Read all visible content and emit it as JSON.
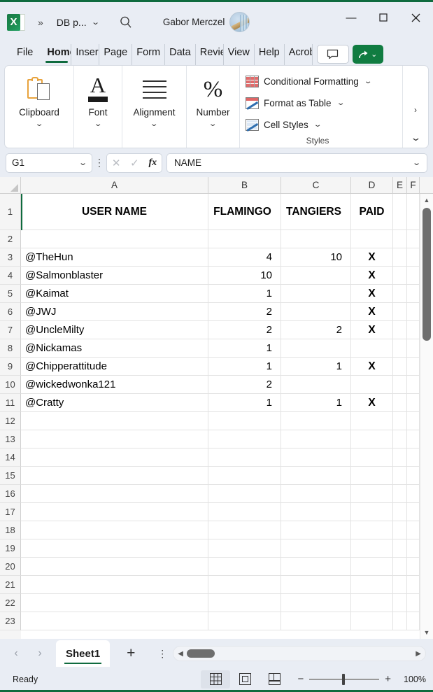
{
  "titlebar": {
    "app_icon": "excel-logo",
    "app_letter": "X",
    "overflow_label": "»",
    "document_title": "DB p...",
    "title_caret": "⌄",
    "search_icon": "search-icon",
    "account_name": "Gabor Merczel",
    "minimize": "—",
    "maximize": "☐",
    "close": "✕"
  },
  "tabs": [
    {
      "label": "File",
      "active": false
    },
    {
      "label": "Home",
      "active": true
    },
    {
      "label": "Insert",
      "active": false
    },
    {
      "label": "Page",
      "active": false
    },
    {
      "label": "Form",
      "active": false
    },
    {
      "label": "Data",
      "active": false
    },
    {
      "label": "Revie",
      "active": false
    },
    {
      "label": "View",
      "active": false
    },
    {
      "label": "Help",
      "active": false
    },
    {
      "label": "Acrob",
      "active": false
    }
  ],
  "tab_actions": {
    "comment_icon": "comment-icon",
    "share_icon": "share-icon",
    "share_caret": "⌄"
  },
  "ribbon": {
    "groups": [
      {
        "label": "Clipboard",
        "icon": "clipboard-icon",
        "caret": "⌄"
      },
      {
        "label": "Font",
        "icon": "font-icon",
        "caret": "⌄"
      },
      {
        "label": "Alignment",
        "icon": "alignment-icon",
        "caret": "⌄"
      },
      {
        "label": "Number",
        "icon": "percent-icon",
        "caret": "⌄"
      }
    ],
    "styles": {
      "caption": "Styles",
      "items": [
        {
          "label": "Conditional Formatting",
          "caret": "⌄",
          "icon": "conditional-formatting-icon"
        },
        {
          "label": "Format as Table",
          "caret": "⌄",
          "icon": "format-as-table-icon"
        },
        {
          "label": "Cell Styles",
          "caret": "⌄",
          "icon": "cell-styles-icon"
        }
      ]
    },
    "expand_label": "›",
    "collapse_label": "⌄"
  },
  "formulabar": {
    "name_box_value": "G1",
    "name_box_caret": "⌄",
    "options_dots": "⋮",
    "cancel_icon": "✕",
    "confirm_icon": "✓",
    "fx_label": "fx",
    "formula_value": "NAME",
    "expand_caret": "⌄"
  },
  "grid": {
    "columns": [
      "A",
      "B",
      "C",
      "D",
      "E",
      "F"
    ],
    "rows": [
      {
        "num": "1",
        "a": "USER NAME",
        "b": "FLAMINGO",
        "c": "TANGIERS",
        "d": "PAID",
        "header": true
      },
      {
        "num": "2",
        "a": "",
        "b": "",
        "c": "",
        "d": ""
      },
      {
        "num": "3",
        "a": "@TheHun",
        "b": "4",
        "c": "10",
        "d": "X"
      },
      {
        "num": "4",
        "a": "@Salmonblaster",
        "b": "10",
        "c": "",
        "d": "X"
      },
      {
        "num": "5",
        "a": "@Kaimat",
        "b": "1",
        "c": "",
        "d": "X"
      },
      {
        "num": "6",
        "a": "@JWJ",
        "b": "2",
        "c": "",
        "d": "X"
      },
      {
        "num": "7",
        "a": "@UncleMilty",
        "b": "2",
        "c": "2",
        "d": "X"
      },
      {
        "num": "8",
        "a": "@Nickamas",
        "b": "1",
        "c": "",
        "d": ""
      },
      {
        "num": "9",
        "a": "@Chipperattitude",
        "b": "1",
        "c": "1",
        "d": "X"
      },
      {
        "num": "10",
        "a": "@wickedwonka121",
        "b": "2",
        "c": "",
        "d": ""
      },
      {
        "num": "11",
        "a": "@Cratty",
        "b": "1",
        "c": "1",
        "d": "X"
      },
      {
        "num": "12",
        "a": "",
        "b": "",
        "c": "",
        "d": ""
      },
      {
        "num": "13",
        "a": "",
        "b": "",
        "c": "",
        "d": ""
      },
      {
        "num": "14",
        "a": "",
        "b": "",
        "c": "",
        "d": ""
      },
      {
        "num": "15",
        "a": "",
        "b": "",
        "c": "",
        "d": ""
      },
      {
        "num": "16",
        "a": "",
        "b": "",
        "c": "",
        "d": ""
      },
      {
        "num": "17",
        "a": "",
        "b": "",
        "c": "",
        "d": ""
      },
      {
        "num": "18",
        "a": "",
        "b": "",
        "c": "",
        "d": ""
      },
      {
        "num": "19",
        "a": "",
        "b": "",
        "c": "",
        "d": ""
      },
      {
        "num": "20",
        "a": "",
        "b": "",
        "c": "",
        "d": ""
      },
      {
        "num": "21",
        "a": "",
        "b": "",
        "c": "",
        "d": ""
      },
      {
        "num": "22",
        "a": "",
        "b": "",
        "c": "",
        "d": ""
      },
      {
        "num": "23",
        "a": "",
        "b": "",
        "c": "",
        "d": ""
      }
    ],
    "scroll_up_icon": "▲",
    "scroll_down_icon": "▼"
  },
  "sheetbar": {
    "prev_icon": "‹",
    "next_icon": "›",
    "sheets": [
      {
        "label": "Sheet1",
        "active": true
      }
    ],
    "add_label": "+",
    "more_dots": "⋮",
    "hscroll_left": "◀",
    "hscroll_right": "▶"
  },
  "statusbar": {
    "status": "Ready",
    "views": [
      {
        "name": "normal-view",
        "active": true
      },
      {
        "name": "page-layout-view",
        "active": false
      },
      {
        "name": "page-break-view",
        "active": false
      }
    ],
    "zoom_out": "−",
    "zoom_in": "+",
    "zoom_level": "100%"
  }
}
